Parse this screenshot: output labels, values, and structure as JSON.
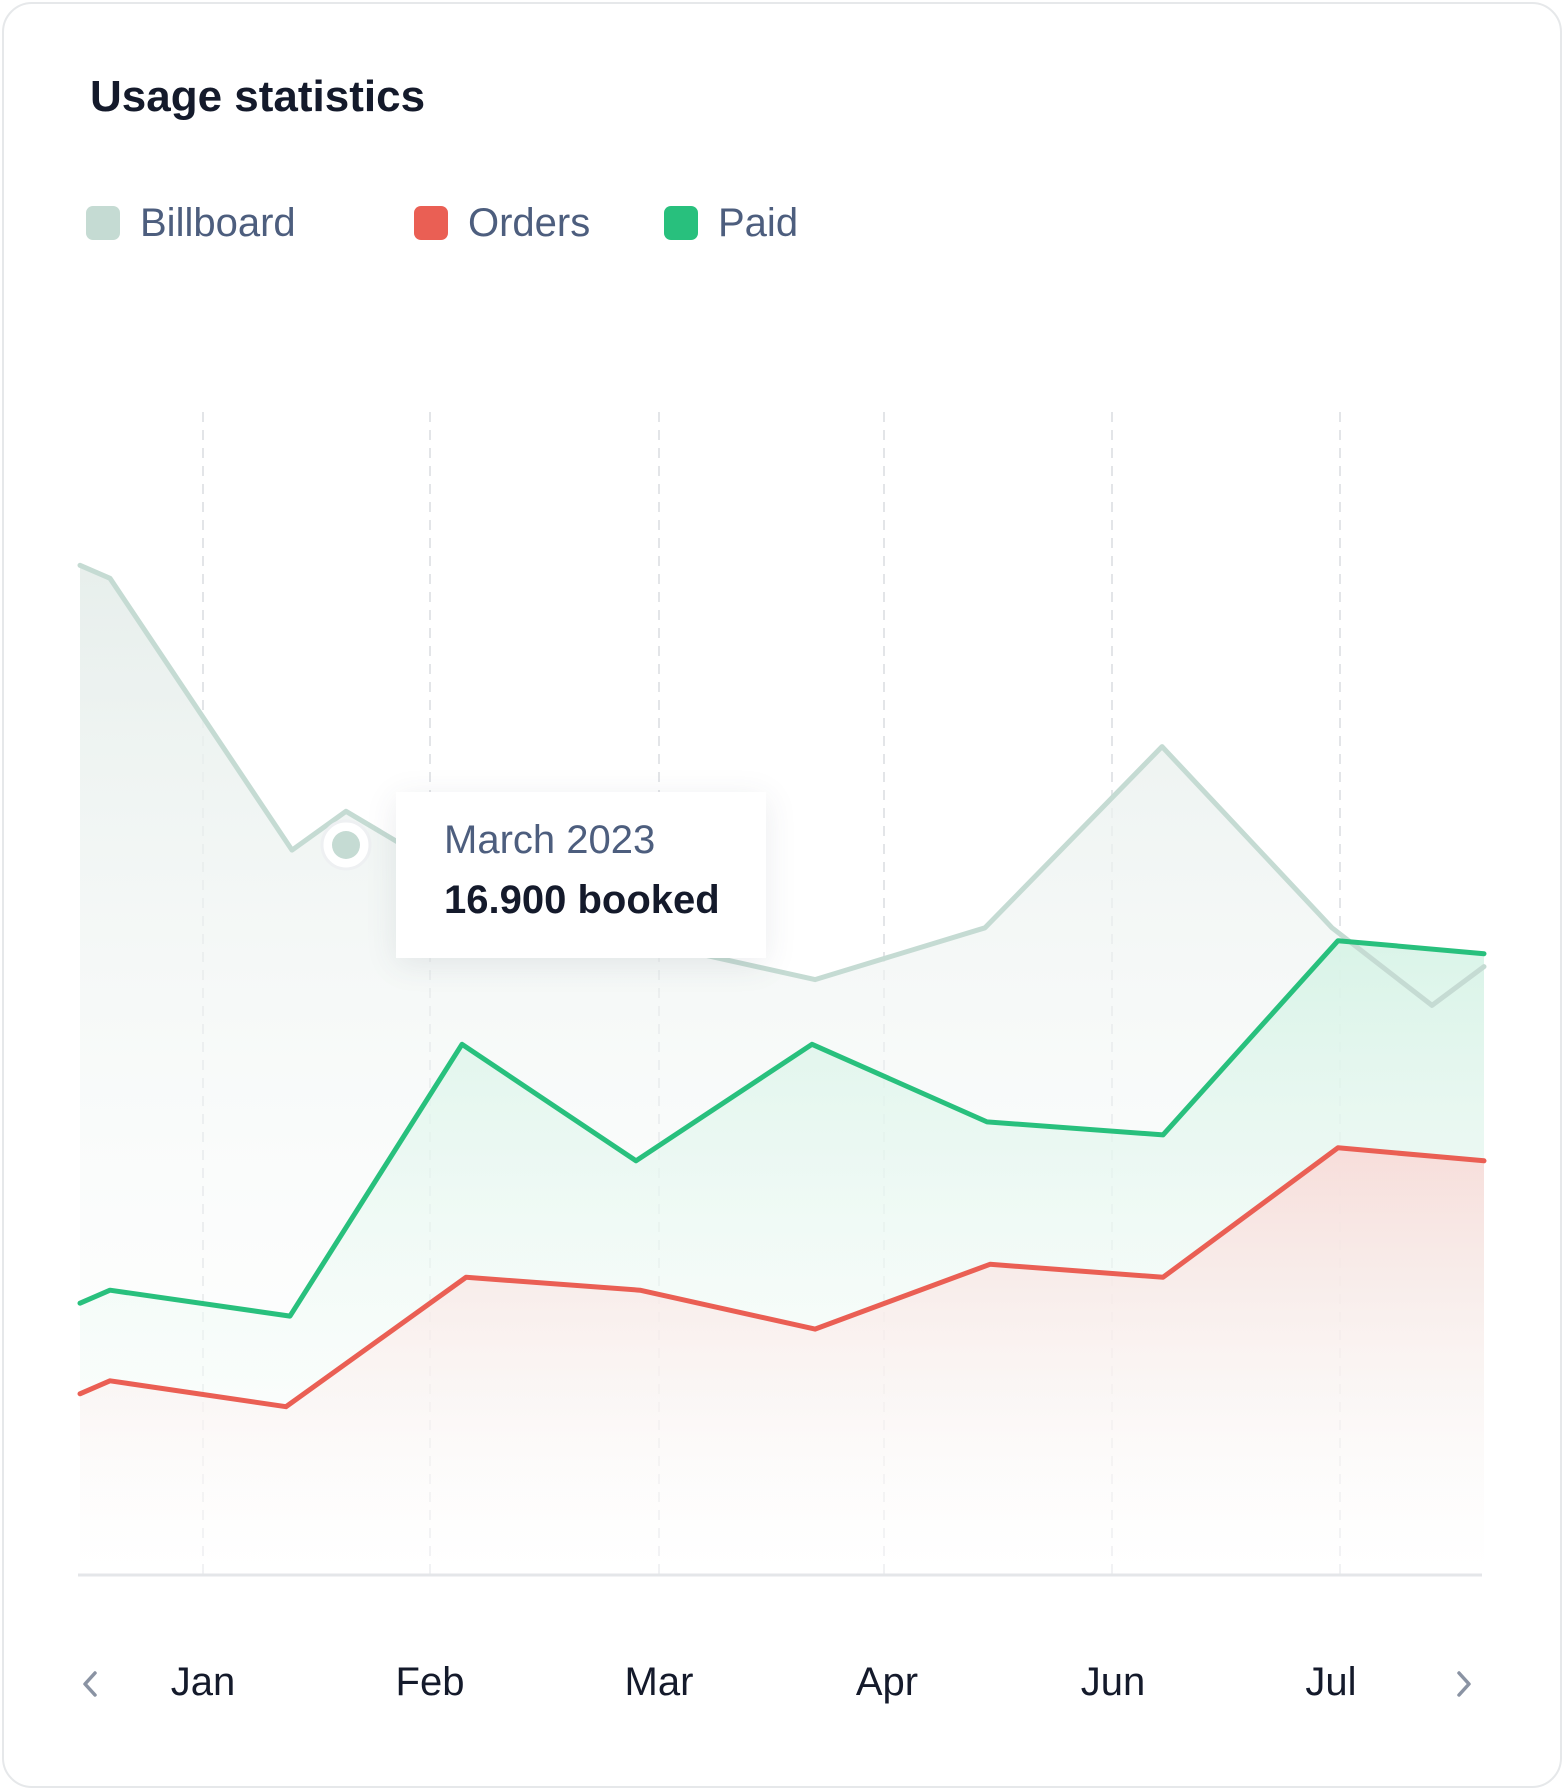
{
  "card": {
    "title": "Usage statistics"
  },
  "tooltip": {
    "month": "March 2023",
    "value": "16.900 booked"
  },
  "navigation": {
    "prev_icon": "chevron-left-icon",
    "next_icon": "chevron-right-icon"
  },
  "chart_data": {
    "type": "area",
    "title": "Usage statistics",
    "xlabel": "",
    "ylabel": "",
    "categories": [
      "Jan",
      "Feb",
      "Mar",
      "Apr",
      "Jun",
      "Jul"
    ],
    "grid": "vertical dashed",
    "legend_position": "top-left",
    "series": [
      {
        "name": "Billboard",
        "color": "#c5dbd3",
        "values": [
          18.8,
          18.7,
          16.6,
          16.9,
          16.1,
          15.9,
          15.6,
          16.0,
          17.4,
          16.0,
          15.4,
          15.7
        ]
      },
      {
        "name": "Paid",
        "color": "#28c07d",
        "values": [
          13.1,
          13.2,
          13.0,
          15.1,
          14.2,
          15.1,
          14.5,
          14.4,
          15.9,
          15.8
        ]
      },
      {
        "name": "Orders",
        "color": "#ea5f54",
        "values": [
          12.4,
          12.5,
          12.3,
          13.3,
          13.2,
          12.9,
          13.4,
          13.3,
          14.3,
          14.2
        ]
      }
    ],
    "highlight": {
      "series": "Billboard",
      "label": "March 2023",
      "value": 16.9
    }
  }
}
